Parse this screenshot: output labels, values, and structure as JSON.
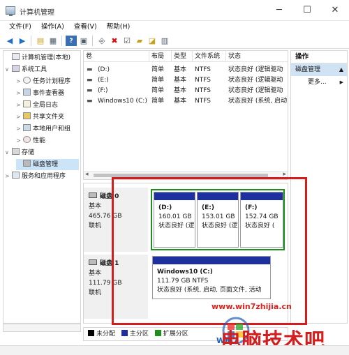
{
  "window": {
    "title": "计算机管理",
    "controls": {
      "minimize": "─",
      "maximize": "☐",
      "close": "✕"
    }
  },
  "menu": [
    "文件(F)",
    "操作(A)",
    "查看(V)",
    "帮助(H)"
  ],
  "toolbar_icons": [
    "back-icon",
    "forward-icon",
    "up-folder-icon",
    "show-hide-tree-icon",
    "help-icon",
    "properties-icon",
    "connect-icon",
    "delete-icon",
    "check-icon",
    "folder-open-icon",
    "folder-search-icon",
    "console-icon"
  ],
  "tree": {
    "items": [
      {
        "label": "计算机管理(本地)",
        "twisty": "",
        "icon": "computer-management-icon"
      },
      {
        "label": "系统工具",
        "twisty": "∨",
        "icon": "tools-icon"
      },
      {
        "label": "任务计划程序",
        "twisty": ">",
        "icon": "clock-icon"
      },
      {
        "label": "事件查看器",
        "twisty": ">",
        "icon": "event-viewer-icon"
      },
      {
        "label": "全局日志",
        "twisty": ">",
        "icon": "log-icon"
      },
      {
        "label": "共享文件夹",
        "twisty": ">",
        "icon": "shared-folder-icon"
      },
      {
        "label": "本地用户和组",
        "twisty": ">",
        "icon": "users-icon"
      },
      {
        "label": "性能",
        "twisty": ">",
        "icon": "performance-icon"
      },
      {
        "label": "存储",
        "twisty": "∨",
        "icon": "storage-icon"
      },
      {
        "label": "磁盘管理",
        "twisty": "",
        "icon": "disk-management-icon"
      },
      {
        "label": "服务和应用程序",
        "twisty": ">",
        "icon": "services-icon"
      }
    ]
  },
  "volumes": {
    "columns": [
      "卷",
      "布局",
      "类型",
      "文件系统",
      "状态"
    ],
    "rows": [
      [
        "(D:)",
        "简单",
        "基本",
        "NTFS",
        "状态良好 (逻辑驱动"
      ],
      [
        "(E:)",
        "简单",
        "基本",
        "NTFS",
        "状态良好 (逻辑驱动"
      ],
      [
        "(F:)",
        "简单",
        "基本",
        "NTFS",
        "状态良好 (逻辑驱动"
      ],
      [
        "Windows10 (C:)",
        "简单",
        "基本",
        "NTFS",
        "状态良好 (系统, 启动"
      ]
    ],
    "scroll_left": "◂",
    "scroll_right": "▸"
  },
  "disks": [
    {
      "name": "磁盘 0",
      "type": "基本",
      "size": "465.76 GB",
      "status": "联机",
      "partitions": [
        {
          "name": "(D:)",
          "size": "160.01 GB",
          "status": "状态良好 (逻"
        },
        {
          "name": "(E:)",
          "size": "153.01 GB",
          "status": "状态良好 (逻"
        },
        {
          "name": "(F:)",
          "size": "152.74 GB",
          "status": "状态良好 ("
        }
      ]
    },
    {
      "name": "磁盘 1",
      "type": "基本",
      "size": "111.79 GB",
      "status": "联机",
      "partitions": [
        {
          "name": "Windows10  (C:)",
          "size": "111.79 GB NTFS",
          "status": "状态良好 (系统, 启动, 页面文件, 活动"
        }
      ]
    }
  ],
  "legend": [
    {
      "label": "未分配",
      "color": "#000000"
    },
    {
      "label": "主分区",
      "color": "#1e2fa0"
    },
    {
      "label": "扩展分区",
      "color": "#1d8f1d"
    }
  ],
  "actions": {
    "title": "操作",
    "section": "磁盘管理",
    "section_arrow": "▲",
    "more": "更多...",
    "more_arrow": "▶"
  },
  "watermark": {
    "url": "www.win7zhijia.cn",
    "title": "电脑技术吧",
    "logo_text": "Win7"
  },
  "colors": {
    "primary_partition": "#1e2fa0",
    "extended_partition": "#1d8f1d",
    "highlight": "#d31e1e",
    "selection": "#cce4f7"
  }
}
